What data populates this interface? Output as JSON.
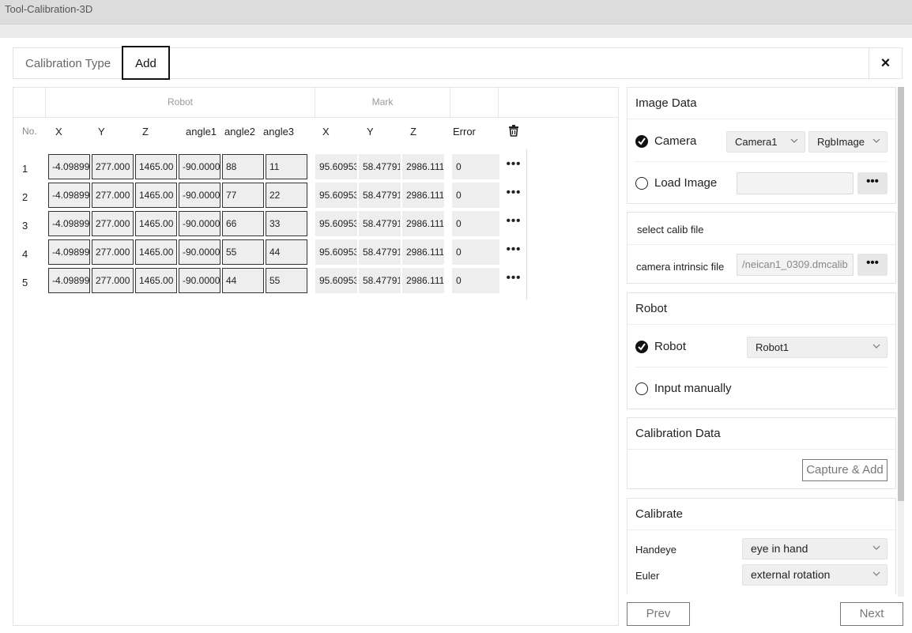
{
  "window": {
    "title": "Tool-Calibration-3D"
  },
  "tabs": [
    {
      "label": "Calibration Type"
    },
    {
      "label": "Add"
    }
  ],
  "close_icon": "×",
  "table": {
    "group_headers": {
      "robot": "Robot",
      "mark": "Mark"
    },
    "columns": {
      "no": "No.",
      "rx": "X",
      "ry": "Y",
      "rz": "Z",
      "a1": "angle1",
      "a2": "angle2",
      "a3": "angle3",
      "mx": "X",
      "my": "Y",
      "mz": "Z",
      "error": "Error"
    },
    "rows": [
      {
        "no": "1",
        "x": "-4.09899",
        "y": "277.000",
        "z": "1465.00",
        "a1": "-90.0000",
        "a2": "88",
        "a3": "11",
        "mx": "95.60953",
        "my": "58.47791",
        "mz": "2986.111",
        "err": "0"
      },
      {
        "no": "2",
        "x": "-4.09899",
        "y": "277.000",
        "z": "1465.00",
        "a1": "-90.0000",
        "a2": "77",
        "a3": "22",
        "mx": "95.60953",
        "my": "58.47791",
        "mz": "2986.111",
        "err": "0"
      },
      {
        "no": "3",
        "x": "-4.09899",
        "y": "277.000",
        "z": "1465.00",
        "a1": "-90.0000",
        "a2": "66",
        "a3": "33",
        "mx": "95.60953",
        "my": "58.47791",
        "mz": "2986.111",
        "err": "0"
      },
      {
        "no": "4",
        "x": "-4.09899",
        "y": "277.000",
        "z": "1465.00",
        "a1": "-90.0000",
        "a2": "55",
        "a3": "44",
        "mx": "95.60953",
        "my": "58.47791",
        "mz": "2986.111",
        "err": "0"
      },
      {
        "no": "5",
        "x": "-4.09899",
        "y": "277.000",
        "z": "1465.00",
        "a1": "-90.0000",
        "a2": "44",
        "a3": "55",
        "mx": "95.60953",
        "my": "58.47791",
        "mz": "2986.111",
        "err": "0"
      }
    ],
    "more_icon": "•••"
  },
  "image_data": {
    "title": "Image Data",
    "camera_label": "Camera",
    "camera_selected": "Camera1",
    "image_type_selected": "RgbImage",
    "load_image_label": "Load Image",
    "load_image_value": "",
    "browse_label": "•••"
  },
  "calib_file": {
    "title": "select calib file",
    "intrinsic_label": "camera intrinsic file",
    "intrinsic_value": "/neican1_0309.dmcalib",
    "browse_label": "•••"
  },
  "robot": {
    "title": "Robot",
    "robot_label": "Robot",
    "robot_selected": "Robot1",
    "manual_label": "Input manually"
  },
  "calibration_data": {
    "title": "Calibration Data",
    "capture_label": "Capture & Add"
  },
  "calibrate": {
    "title": "Calibrate",
    "handeye_label": "Handeye",
    "handeye_selected": "eye in hand",
    "euler_label": "Euler",
    "euler_selected": "external rotation"
  },
  "footer": {
    "prev_label": "Prev",
    "next_label": "Next"
  }
}
